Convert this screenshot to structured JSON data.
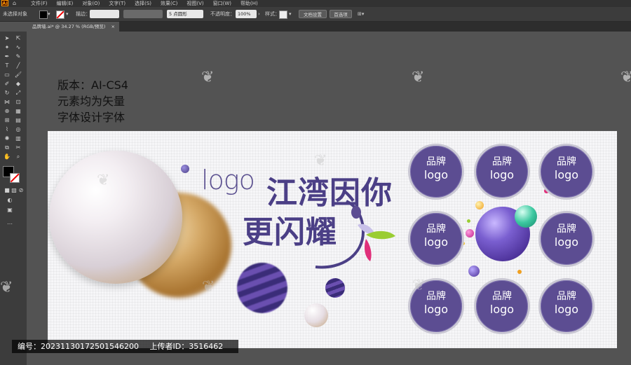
{
  "app": {
    "logo": "Ai",
    "menus": [
      "文件(F)",
      "编辑(E)",
      "对象(O)",
      "文字(T)",
      "选择(S)",
      "效果(C)",
      "视图(V)",
      "窗口(W)",
      "帮助(H)"
    ]
  },
  "control_bar": {
    "selection_status": "未选择对象",
    "stroke_label": "描边：",
    "stroke_value": "",
    "brush_value": "5 点圆形",
    "opacity_label": "不透明度：",
    "opacity_value": "100%",
    "style_label": "样式：",
    "doc_setup_button": "文档设置",
    "preferences_button": "首选项"
  },
  "document_tab": {
    "title": "品牌墙.ai* @ 34.27 % (RGB/预览)",
    "close": "×"
  },
  "canvas_note": {
    "lines": [
      "版本：AI-CS4",
      "元素均为矢量",
      "字体设计字体"
    ]
  },
  "artwork": {
    "logo_text": "logo",
    "slogan_line1": "江湾因你",
    "slogan_line2": "更闪耀",
    "badges": [
      {
        "line1": "品牌",
        "line2": "logo"
      },
      {
        "line1": "品牌",
        "line2": "logo"
      },
      {
        "line1": "品牌",
        "line2": "logo"
      },
      {
        "line1": "品牌",
        "line2": "logo"
      },
      {
        "line1": "品牌",
        "line2": "logo"
      },
      {
        "line1": "品牌",
        "line2": "logo"
      },
      {
        "line1": "品牌",
        "line2": "logo"
      },
      {
        "line1": "品牌",
        "line2": "logo"
      }
    ],
    "colors": {
      "purple": "#5c4d92",
      "gold": "#c79a55",
      "pearl": "#efe9ee"
    }
  },
  "footer": {
    "id_label": "编号：20231130172501546200",
    "uploader_label": "上传者ID：3516462"
  }
}
